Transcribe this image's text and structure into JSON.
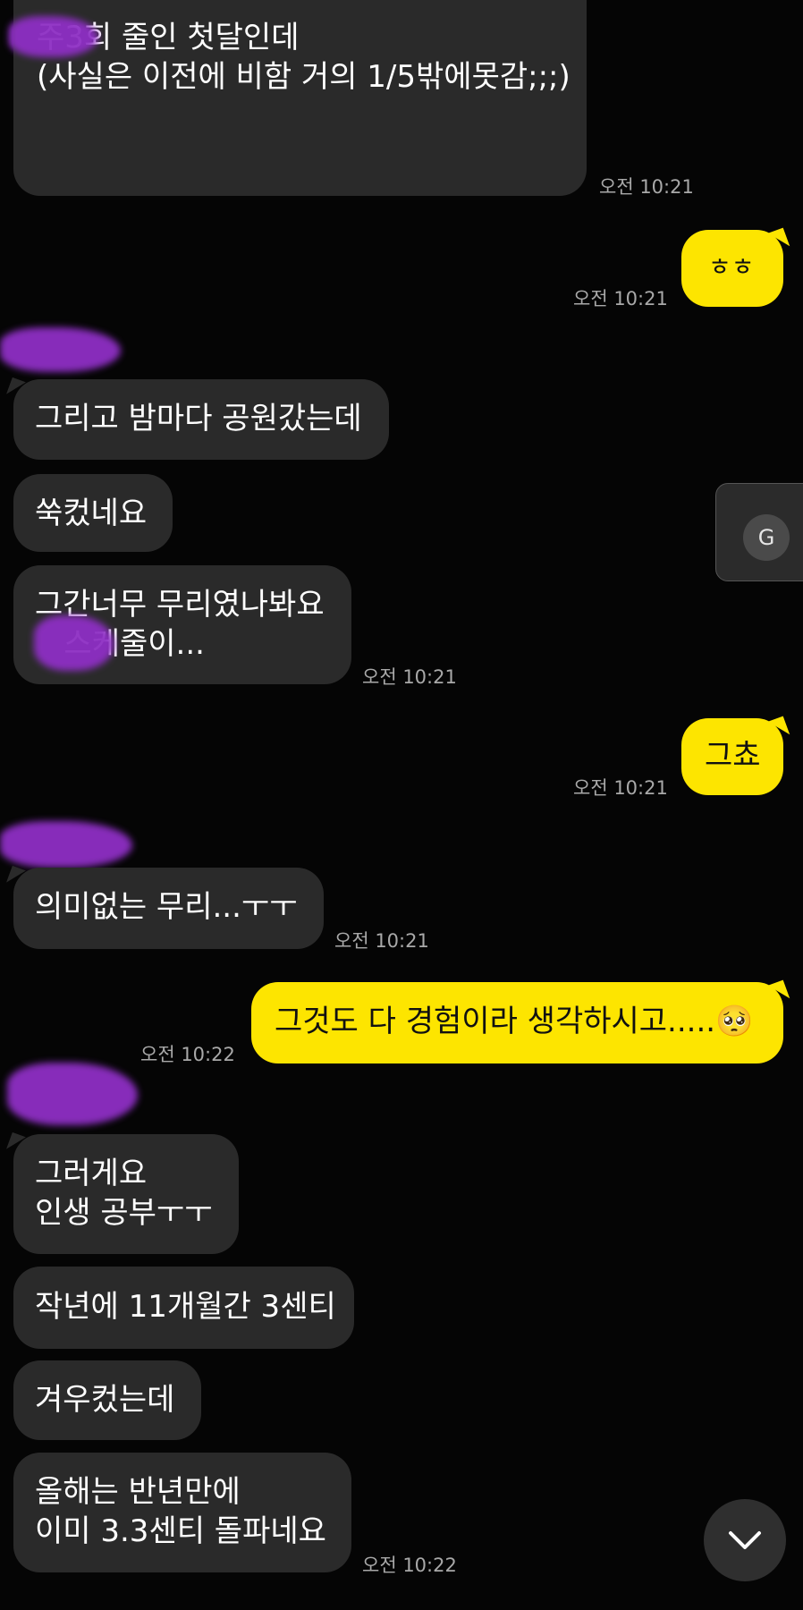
{
  "messages": {
    "m1_text": "주3회 줄인 첫달인데\n(사실은 이전에 비함 거의 1/5밖에못감;;;)",
    "m1_time": "오전 10:21",
    "m2_text": "ㅎㅎ",
    "m2_time": "오전 10:21",
    "m3_text": "그리고 밤마다 공원갔는데",
    "m4_text": "쑥컸네요",
    "m5_text": "그간너무 무리였나봐요\n   스케줄이...",
    "m5_time": "오전 10:21",
    "m6_text": "그쵸",
    "m6_time": "오전 10:21",
    "m7_text": "의미없는 무리...ㅜㅜ",
    "m7_time": "오전 10:21",
    "m8_text": "그것도 다 경험이라 생각하시고.....🥺",
    "m8_time": "오전 10:22",
    "m9_text": "그러게요\n인생 공부ㅜㅜ",
    "m10_text": "작년에 11개월간 3센티",
    "m11_text": "겨우컸는데",
    "m12_text": "올해는 반년만에\n이미 3.3센티 돌파네요",
    "m12_time": "오전 10:22"
  },
  "ui": {
    "translate_label": "G",
    "scroll_down_icon": "chevron-down-icon"
  },
  "colors": {
    "background": "#050505",
    "incoming_bubble": "#2a2a2a",
    "outgoing_bubble": "#fde500",
    "redaction": "#8e2fc4"
  }
}
